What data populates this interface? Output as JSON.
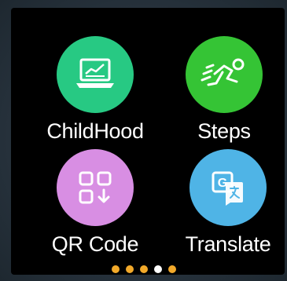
{
  "apps": [
    {
      "label": "ChildHood",
      "icon": "laptop-chart-icon",
      "color": "#27c983"
    },
    {
      "label": "Steps",
      "icon": "running-person-icon",
      "color": "#35c435"
    },
    {
      "label": "QR Code",
      "icon": "qr-code-icon",
      "color": "#d88ee3"
    },
    {
      "label": "Translate",
      "icon": "translate-icon",
      "color": "#4fb4e6"
    }
  ],
  "page_indicator": {
    "count": 5,
    "active_index": 3,
    "inactive_color": "#f2a92a",
    "active_color": "#ffffff"
  }
}
